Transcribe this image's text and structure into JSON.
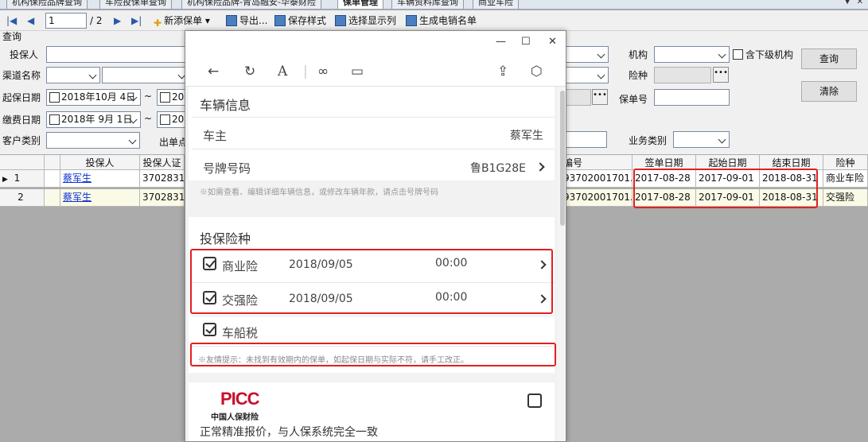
{
  "tabs": [
    "机构保险品牌查询",
    "车险投保单查询",
    "机构保险品牌-青岛融安-华泰财险",
    "保单管理",
    "车辆资料库查询",
    "商业车险"
  ],
  "tab_close": "✕",
  "tab_arrow": "▼",
  "toolbar": {
    "page_value": "1",
    "page_total": "/ 2",
    "new_label": "新添保单",
    "export_label": "导出...",
    "save_style_label": "保存样式",
    "select_columns_label": "选择显示列",
    "gen_list_label": "生成电销名单"
  },
  "form": {
    "group_title": "查询",
    "insured_label": "投保人",
    "channel_label": "渠道名称",
    "start_date_label": "起保日期",
    "start_date_value": "2018年10月 4日",
    "start_date_value2": "201",
    "tilde": "~",
    "pay_date_label": "缴费日期",
    "pay_date_value": "2018年 9月 1日",
    "pay_date_value2": "201",
    "customer_type_label": "客户类别",
    "issue_point_label": "出单点",
    "org_label": "机构",
    "include_sub_label": "含下级机构",
    "insurance_type_label": "险种",
    "policy_no_label": "保单号",
    "business_type_label": "业务类别",
    "query_button": "查询",
    "clear_button": "清除"
  },
  "grid": {
    "headers": [
      "投保人",
      "投保人证",
      "编号",
      "签单日期",
      "起始日期",
      "结束日期",
      "险种"
    ],
    "rows": [
      {
        "index": "1",
        "insured": "蔡军生",
        "id": "370283198",
        "policy": "93702001701...",
        "sign": "2017-08-28",
        "start": "2017-09-01",
        "end": "2018-08-31",
        "type": "商业车险"
      },
      {
        "index": "2",
        "insured": "蔡军生",
        "id": "370283198",
        "policy": "93702001701...",
        "sign": "2017-08-28",
        "start": "2017-09-01",
        "end": "2018-08-31",
        "type": "交强险"
      }
    ]
  },
  "modal": {
    "win_min": "—",
    "win_max": "☐",
    "win_close": "✕",
    "vehicle_section": "车辆信息",
    "owner_label": "车主",
    "owner_value": "蔡军生",
    "plate_label": "号牌号码",
    "plate_value": "鲁B1G28E",
    "vehicle_note": "※如需查看、编辑详细车辆信息，或修改车辆年款，请点击号牌号码",
    "insurance_section": "投保险种",
    "items": [
      {
        "name": "商业险",
        "date": "2018/09/05",
        "time": "00:00"
      },
      {
        "name": "交强险",
        "date": "2018/09/05",
        "time": "00:00"
      }
    ],
    "tax_label": "车船税",
    "warning": "※友情提示：未找到有效期内的保单，如起保日期与实际不符，请手工改正。",
    "picc_brand": "PICC",
    "picc_name": "中国人保财险",
    "picc_slogan": "正常精准报价，与人保系统完全一致"
  },
  "colors": {
    "accent_red": "#e02020",
    "link": "#0b2fd6",
    "picc_red": "#c8102e"
  }
}
